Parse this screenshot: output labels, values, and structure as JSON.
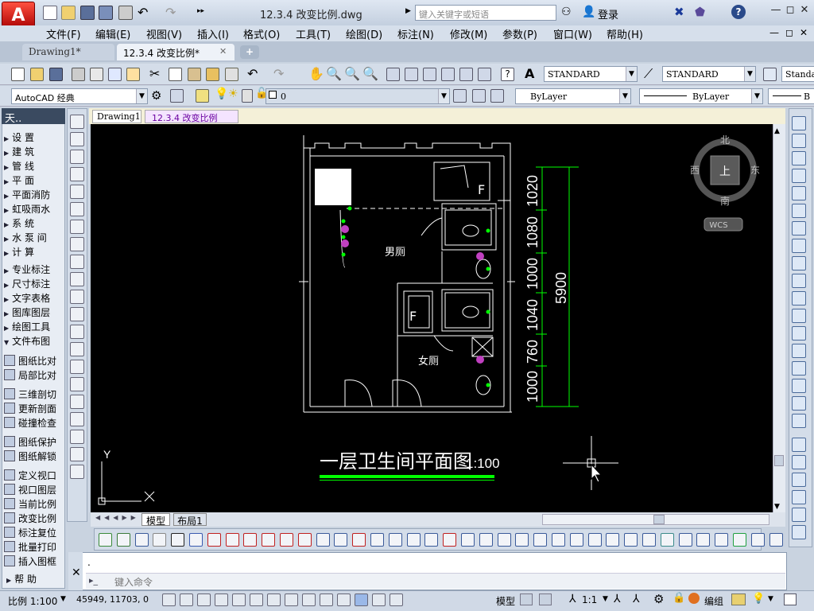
{
  "app": {
    "logo_letter": "A",
    "document_title": "12.3.4  改变比例.dwg",
    "search_placeholder": "键入关键字或短语",
    "login_label": "登录"
  },
  "window_controls": {
    "minimize": "—",
    "restore": "◻",
    "close": "✕",
    "help": "?"
  },
  "menu": [
    "文件(F)",
    "编辑(E)",
    "视图(V)",
    "插入(I)",
    "格式(O)",
    "工具(T)",
    "绘图(D)",
    "标注(N)",
    "修改(M)",
    "参数(P)",
    "窗口(W)",
    "帮助(H)"
  ],
  "file_tabs": [
    {
      "label": "Drawing1*",
      "active": false
    },
    {
      "label": "12.3.4  改变比例*",
      "active": true
    }
  ],
  "toolbar": {
    "text_style": "STANDARD",
    "dim_style": "STANDARD",
    "table_style": "Standa",
    "workspace": "AutoCAD 经典",
    "layer": "0",
    "color": "ByLayer",
    "linetype": "ByLayer",
    "lineweight": "B"
  },
  "left_panel": {
    "title": "天..",
    "items": [
      "设  置",
      "建  筑",
      "管  线",
      "平  面",
      "平面消防",
      "虹吸雨水",
      "系  统",
      "水 泵 间",
      "计  算",
      "专业标注",
      "尺寸标注",
      "文字表格",
      "图库图层",
      "绘图工具",
      "文件布图"
    ],
    "tools": [
      "图纸比对",
      "局部比对",
      "三维剖切",
      "更新剖面",
      "碰撞检查",
      "图纸保护",
      "图纸解锁",
      "定义视口",
      "视口图层",
      "当前比例",
      "改变比例",
      "标注复位",
      "批量打印",
      "插入图框",
      "帮  助"
    ]
  },
  "drawing_tabs": [
    "Drawing1",
    "12.3.4  改变比例"
  ],
  "drawing": {
    "room_labels": [
      "男厕",
      "女厕"
    ],
    "fixture_letter": "F",
    "dimensions": [
      "1020",
      "1080",
      "1000",
      "1040",
      "760",
      "1000"
    ],
    "total_dimension": "5900",
    "title": "一层卫生间平面图",
    "scale": "1:100",
    "ucs_x": "X",
    "ucs_y": "Y"
  },
  "viewcube": {
    "north": "北",
    "south": "南",
    "east": "东",
    "west": "西",
    "face": "上",
    "wcs": "WCS"
  },
  "layout_tabs": [
    "模型",
    "布局1"
  ],
  "command": {
    "output": ".",
    "placeholder": "键入命令"
  },
  "status": {
    "scale_label": "比例 1:100",
    "coords": "45949, 11703, 0",
    "model": "模型",
    "annotation_scale": "1:1",
    "workspace_label": "编组"
  },
  "colors": {
    "canvas": "#000000",
    "walls": "#ffffff",
    "dimension": "#00ff00",
    "title_underline": "#00ff00",
    "fixtures": "#c040c0"
  }
}
